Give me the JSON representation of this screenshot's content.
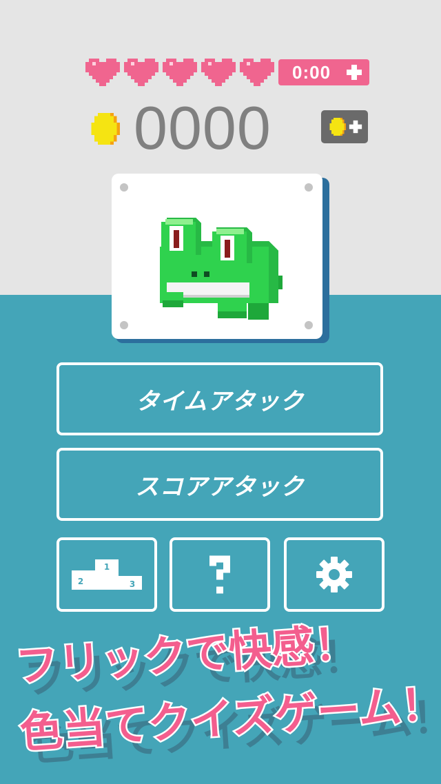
{
  "status": {
    "hearts": [
      "heart-icon",
      "heart-icon",
      "heart-icon",
      "heart-icon",
      "heart-icon"
    ],
    "timer": "0:00",
    "coins": "0000"
  },
  "menu": {
    "time_attack": "タイムアタック",
    "score_attack": "スコアアタック",
    "ranking_icon": "podium-icon",
    "help_icon": "question-icon",
    "settings_icon": "gear-icon"
  },
  "promo": {
    "line1": "フリックで快感！",
    "line2": "色当てクイズゲーム！"
  },
  "colors": {
    "top_bg": "#e5e5e5",
    "bottom_bg": "#44a5b8",
    "heart": "#f0658f",
    "coin": "#f5e412",
    "frog": "#2fd24e",
    "promo": "#f35e8e"
  }
}
